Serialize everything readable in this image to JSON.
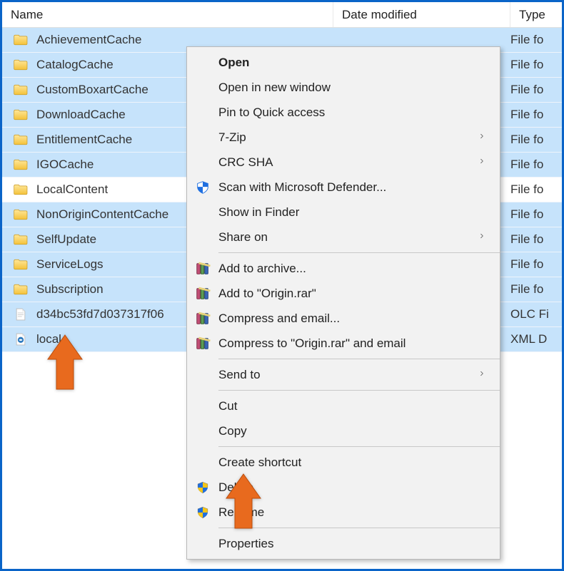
{
  "columns": {
    "name": "Name",
    "date": "Date modified",
    "type": "Type"
  },
  "rows": [
    {
      "icon": "folder",
      "name": "AchievementCache",
      "date": "",
      "type": "File fo",
      "selected": true
    },
    {
      "icon": "folder",
      "name": "CatalogCache",
      "date": "",
      "type": "File fo",
      "selected": true
    },
    {
      "icon": "folder",
      "name": "CustomBoxartCache",
      "date": "",
      "type": "File fo",
      "selected": true
    },
    {
      "icon": "folder",
      "name": "DownloadCache",
      "date": "",
      "type": "File fo",
      "selected": true
    },
    {
      "icon": "folder",
      "name": "EntitlementCache",
      "date": "",
      "type": "File fo",
      "selected": true
    },
    {
      "icon": "folder",
      "name": "IGOCache",
      "date": "",
      "type": "File fo",
      "selected": true
    },
    {
      "icon": "folder",
      "name": "LocalContent",
      "date": "",
      "type": "File fo",
      "selected": false
    },
    {
      "icon": "folder",
      "name": "NonOriginContentCache",
      "date": "",
      "type": "File fo",
      "selected": true
    },
    {
      "icon": "folder",
      "name": "SelfUpdate",
      "date": "",
      "type": "File fo",
      "selected": true
    },
    {
      "icon": "folder",
      "name": "ServiceLogs",
      "date": "",
      "type": "File fo",
      "selected": true
    },
    {
      "icon": "folder",
      "name": "Subscription",
      "date": "",
      "type": "File fo",
      "selected": true
    },
    {
      "icon": "file",
      "name": "d34bc53fd7d037317f06",
      "date": "",
      "type": "OLC Fi",
      "selected": true
    },
    {
      "icon": "xml",
      "name": "local",
      "date": "",
      "type": "XML D",
      "selected": true
    }
  ],
  "menu": {
    "open": "Open",
    "open_new": "Open in new window",
    "pin": "Pin to Quick access",
    "sevenzip": "7-Zip",
    "crc": "CRC SHA",
    "defender": "Scan with Microsoft Defender...",
    "finder": "Show in Finder",
    "shareon": "Share on",
    "archive": "Add to archive...",
    "addrar": "Add to \"Origin.rar\"",
    "compemail": "Compress and email...",
    "comprar": "Compress to \"Origin.rar\" and email",
    "sendto": "Send to",
    "cut": "Cut",
    "copy": "Copy",
    "shortcut": "Create shortcut",
    "delete": "Delete",
    "rename": "Rename",
    "properties": "Properties"
  }
}
